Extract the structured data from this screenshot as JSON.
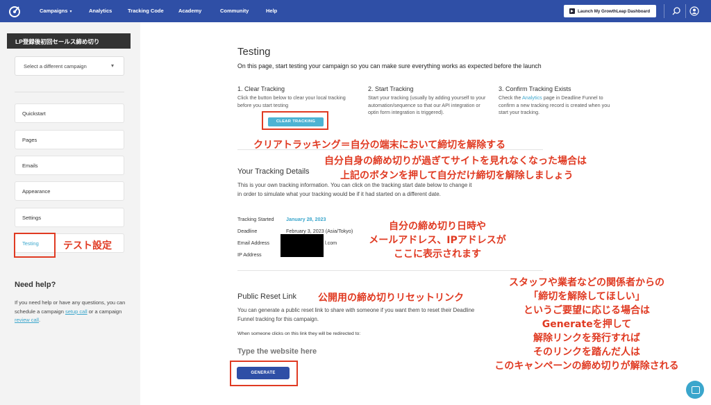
{
  "nav": {
    "items": [
      "Campaigns",
      "Analytics",
      "Tracking Code",
      "Academy",
      "Community",
      "Help"
    ],
    "caret": "▾",
    "launch_button": "Launch My GrowthLeap Dashboard",
    "icons": [
      "logo-icon",
      "search-icon",
      "user-icon"
    ]
  },
  "sidebar": {
    "campaign_name": "LP登録後初回セールス締め切り",
    "select_placeholder": "Select a different campaign",
    "items": [
      "Quickstart",
      "Pages",
      "Emails",
      "Appearance",
      "Settings",
      "Testing"
    ],
    "active_item": "Testing",
    "help": {
      "title": "Need help?",
      "text_before": "If you need help or have any questions, you can schedule a campaign ",
      "link1": "setup call",
      "text_mid": " or a campaign ",
      "link2": "review call",
      "text_after": "."
    }
  },
  "main": {
    "title": "Testing",
    "intro": "On this page, start testing your campaign so you can make sure everything works as expected before the launch",
    "steps": [
      {
        "title": "1. Clear Tracking",
        "text": "Click the button below to clear your local tracking before you start testing"
      },
      {
        "title": "2. Start Tracking",
        "text": "Start your tracking (usually by adding yourself to your automation/sequence so that our API integration or optin form integration is triggered)."
      },
      {
        "title": "3. Confirm Tracking Exists",
        "text_before": "Check the ",
        "link": "Analytics",
        "text_after": " page in Deadline Funnel to confirm a new tracking record is created when you start your tracking."
      }
    ],
    "clear_button": "CLEAR TRACKING",
    "tracking_details": {
      "title": "Your Tracking Details",
      "desc": "This is your own tracking information. You can click on the tracking start date below to change it in order to simulate what your tracking would be if it had started on a different date.",
      "rows": [
        {
          "label": "Tracking Started",
          "value": "January 28, 2023"
        },
        {
          "label": "Deadline",
          "value": "February 3, 2023 (Asia/Tokyo)"
        },
        {
          "label": "Email Address",
          "value": "l.com"
        },
        {
          "label": "IP Address",
          "value": ""
        }
      ]
    },
    "reset": {
      "title": "Public Reset Link",
      "desc": "You can generate a public reset link to share with someone if you want them to reset their Deadline Funnel tracking for this campaign.",
      "redirect_label": "When someone clicks on this link they will be redirected to:",
      "input_placeholder": "Type the website here",
      "generate_button": "GENERATE"
    }
  },
  "annotations": {
    "testing_label": "テスト設定",
    "clear_line1": "クリアトラッキング＝自分の端末において締切を解除する",
    "clear_line2": "自分自身の締め切りが過ぎてサイトを見れなくなった場合は",
    "clear_line3": "上記のボタンを押して自分だけ締切を解除しましょう",
    "details_line1": "自分の締め切り日時や",
    "details_line2": "メールアドレス、IPアドレスが",
    "details_line3": "ここに表示されます",
    "reset_label": "公開用の締め切りリセットリンク",
    "staff_lines": [
      "スタッフや業者などの関係者からの",
      "「締切を解除してほしい」",
      "というご要望に応じる場合は",
      "Generateを押して",
      "解除リンクを発行すれば",
      "そのリンクを踏んだ人は",
      "このキャンペーンの締め切りが解除される"
    ],
    "color": "#e03a22"
  }
}
